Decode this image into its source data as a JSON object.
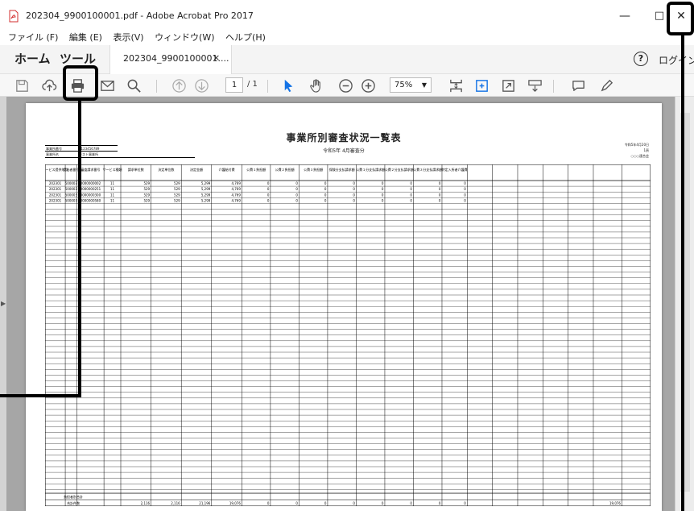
{
  "window": {
    "title": "202304_9900100001.pdf - Adobe Acrobat Pro 2017",
    "minimize": "—",
    "maximize": "□",
    "close": "✕"
  },
  "menu": [
    "ファイル (F)",
    "編集 (E)",
    "表示(V)",
    "ウィンドウ(W)",
    "ヘルプ(H)"
  ],
  "nav": {
    "home": "ホーム",
    "tools": "ツール",
    "tab_label": "202304_9900100001....",
    "tab_close": "×",
    "help": "?",
    "login": "ログイン"
  },
  "toolbar": {
    "page_current": "1",
    "page_total": "/ 1",
    "zoom": "75%",
    "zoom_arrow": "▼"
  },
  "document": {
    "title": "事業所別審査状況一覧表",
    "subtitle": "令和5年 4月審査分",
    "right_info": [
      "令和5年4月20日",
      "1頁",
      "○○○連合会"
    ],
    "header_labels": [
      "事業所番号",
      "事業所名"
    ],
    "header_values": [
      "0123456789",
      "テスト事業所"
    ],
    "columns": [
      "サービス提供年月",
      "受給者番号",
      "審査請求番号",
      "サービス種類",
      "請求単位数",
      "決定単位数",
      "決定金額",
      "介護給付費",
      "公費１負担額",
      "公費２負担額",
      "公費３負担額",
      "保険分支払請求額",
      "公費１分支払請求額",
      "公費２分支払請求額",
      "公費３分支払請求額",
      "特定入所者介護費"
    ],
    "rows": [
      [
        "202301",
        "500003",
        "0000000002",
        "11",
        "529",
        "529",
        "5,299",
        "4,769",
        "0",
        "0",
        "0",
        "0",
        "0",
        "0",
        "0",
        "0"
      ],
      [
        "202301",
        "500003",
        "0000000251",
        "11",
        "529",
        "529",
        "5,299",
        "4,769",
        "0",
        "0",
        "0",
        "0",
        "0",
        "0",
        "0",
        "0"
      ],
      [
        "202301",
        "500003",
        "0000000300",
        "11",
        "529",
        "529",
        "5,299",
        "4,769",
        "0",
        "0",
        "0",
        "0",
        "0",
        "0",
        "0",
        "0"
      ],
      [
        "202301",
        "500003",
        "0000000580",
        "11",
        "529",
        "529",
        "5,299",
        "4,769",
        "0",
        "0",
        "0",
        "0",
        "0",
        "0",
        "0",
        "0"
      ]
    ],
    "footer_labels": [
      "負担者別合計",
      "合計件数"
    ],
    "footer_values": [
      "2,116",
      "2,116",
      "21,196",
      "19,076",
      "0",
      "0",
      "0",
      "0",
      "0",
      "0",
      "0",
      "0",
      "19,076"
    ]
  },
  "colors": {
    "workspace": "#a6a6a6",
    "annotation": "#000000",
    "accent_blue": "#1473e6",
    "pdf_red": "#d32f2f"
  }
}
